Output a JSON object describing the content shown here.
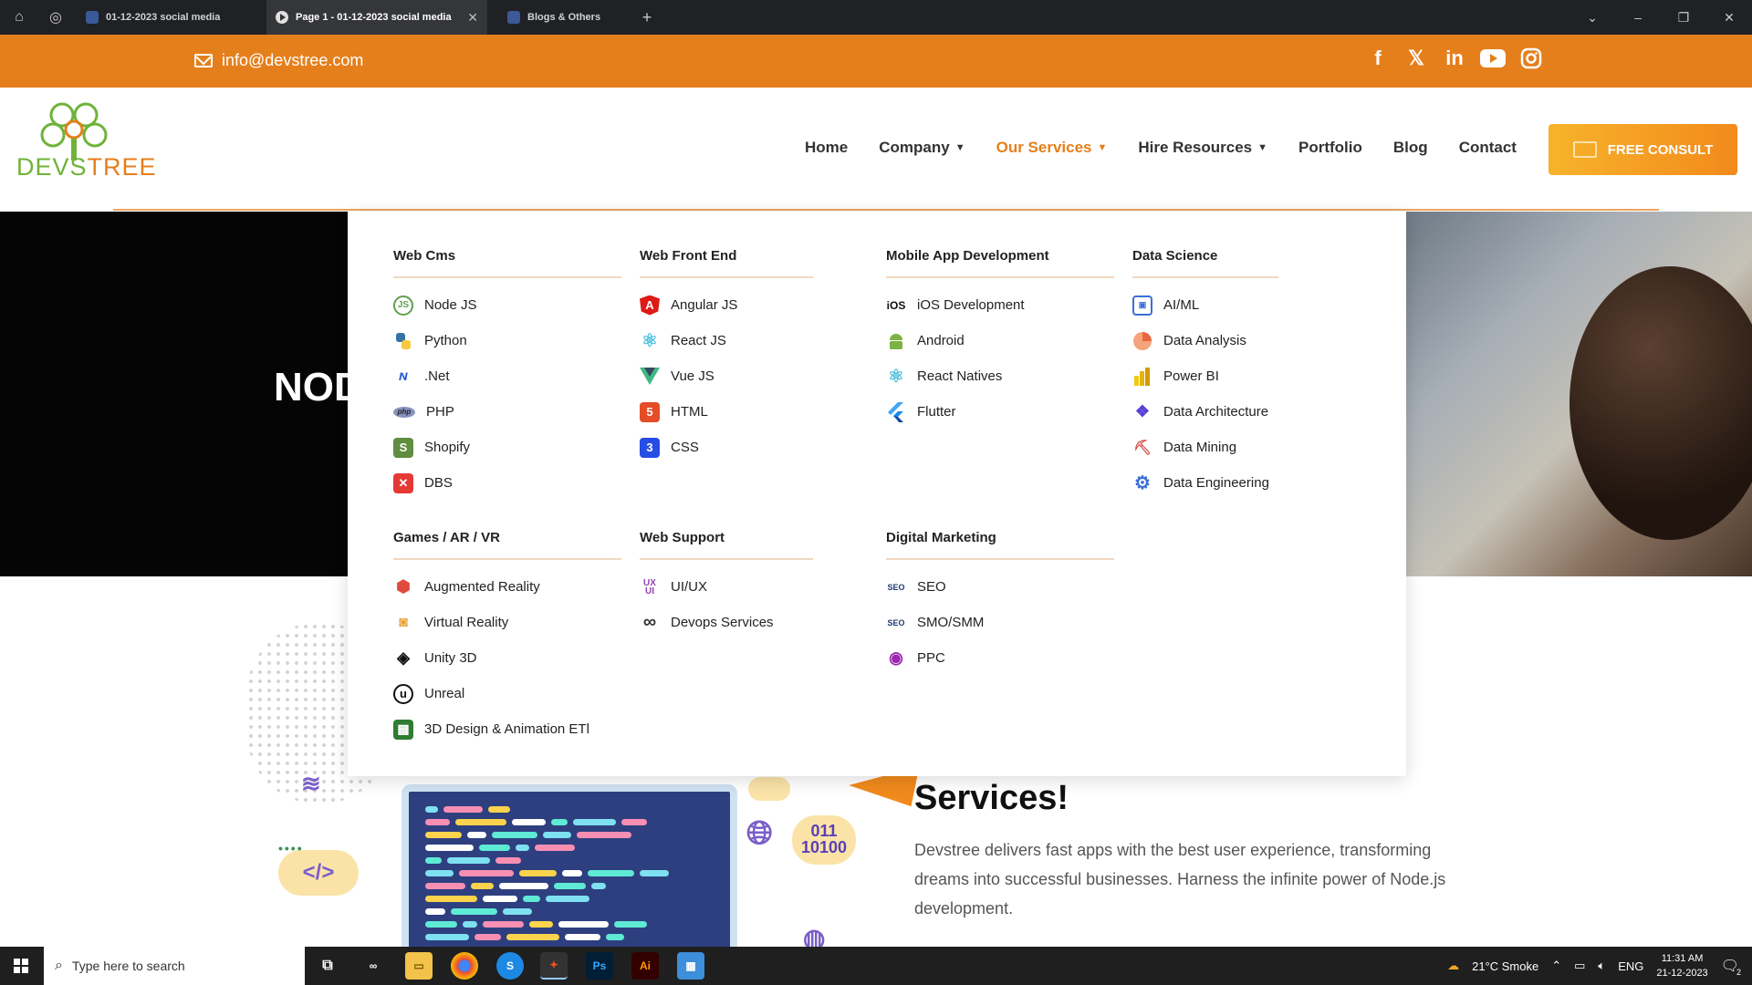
{
  "browser": {
    "tabs": [
      {
        "label": "01-12-2023 social media",
        "active": false
      },
      {
        "label": "Page 1 - 01-12-2023 social media",
        "active": true
      },
      {
        "label": "Blogs & Others",
        "active": false
      }
    ]
  },
  "topbar": {
    "email": "info@devstree.com",
    "social_icons": [
      "facebook-icon",
      "x-icon",
      "linkedin-icon",
      "youtube-icon",
      "instagram-icon"
    ]
  },
  "header": {
    "logo_text_a": "DEVS",
    "logo_text_b": "TREE",
    "nav": [
      {
        "label": "Home",
        "has_caret": false
      },
      {
        "label": "Company",
        "has_caret": true
      },
      {
        "label": "Our Services",
        "has_caret": true,
        "active": true
      },
      {
        "label": "Hire Resources",
        "has_caret": true
      },
      {
        "label": "Portfolio",
        "has_caret": false
      },
      {
        "label": "Blog",
        "has_caret": false
      },
      {
        "label": "Contact",
        "has_caret": false
      }
    ],
    "cta": "FREE CONSULT",
    "accent": "#e57f1c"
  },
  "hero": {
    "title": "NOD"
  },
  "mega_menu": {
    "columns": [
      {
        "title": "Web Cms",
        "items": [
          {
            "label": "Node JS",
            "icon": "nodejs-icon"
          },
          {
            "label": "Python",
            "icon": "python-icon"
          },
          {
            "label": ".Net",
            "icon": "dotnet-icon"
          },
          {
            "label": "PHP",
            "icon": "php-icon"
          },
          {
            "label": "Shopify",
            "icon": "shopify-icon"
          },
          {
            "label": "DBS",
            "icon": "dbs-icon"
          }
        ]
      },
      {
        "title": "Web Front End",
        "items": [
          {
            "label": "Angular JS",
            "icon": "angular-icon"
          },
          {
            "label": "React JS",
            "icon": "react-icon"
          },
          {
            "label": "Vue JS",
            "icon": "vue-icon"
          },
          {
            "label": "HTML",
            "icon": "html5-icon"
          },
          {
            "label": "CSS",
            "icon": "css3-icon"
          }
        ]
      },
      {
        "title": "Mobile App Development",
        "items": [
          {
            "label": "iOS Development",
            "icon": "ios-icon"
          },
          {
            "label": "Android",
            "icon": "android-icon"
          },
          {
            "label": "React Natives",
            "icon": "react-native-icon"
          },
          {
            "label": "Flutter",
            "icon": "flutter-icon"
          }
        ]
      },
      {
        "title": "Data Science",
        "items": [
          {
            "label": "AI/ML",
            "icon": "chip-icon"
          },
          {
            "label": "Data Analysis",
            "icon": "pie-chart-icon"
          },
          {
            "label": "Power BI",
            "icon": "powerbi-icon"
          },
          {
            "label": "Data Architecture",
            "icon": "cubes-icon"
          },
          {
            "label": "Data Mining",
            "icon": "mining-icon"
          },
          {
            "label": "Data Engineering",
            "icon": "gear-data-icon"
          }
        ]
      },
      {
        "title": "Games / AR / VR",
        "items": [
          {
            "label": "Augmented Reality",
            "icon": "ar-cube-icon"
          },
          {
            "label": "Virtual Reality",
            "icon": "vr-headset-icon"
          },
          {
            "label": "Unity  3D",
            "icon": "unity-icon"
          },
          {
            "label": "Unreal",
            "icon": "unreal-icon"
          },
          {
            "label": "3D Design & Animation ETl",
            "icon": "3d-box-icon"
          }
        ]
      },
      {
        "title": "Web Support",
        "items": [
          {
            "label": "UI/UX",
            "icon": "uiux-icon"
          },
          {
            "label": "Devops Services",
            "icon": "infinity-icon"
          }
        ]
      },
      {
        "title": "Digital Marketing",
        "items": [
          {
            "label": "SEO",
            "icon": "seo-icon"
          },
          {
            "label": "SMO/SMM",
            "icon": "smo-icon"
          },
          {
            "label": "PPC",
            "icon": "ppc-icon"
          }
        ]
      }
    ]
  },
  "section": {
    "heading": "Services!",
    "paragraph": "Devstree delivers fast apps with the best user experience, transforming dreams into successful businesses. Harness the infinite power of Node.js development.",
    "binary_text_1": "011",
    "binary_text_2": "10100",
    "code_tag": "</>"
  },
  "taskbar": {
    "search_placeholder": "Type here to search",
    "weather": "21°C  Smoke",
    "language": "ENG",
    "time": "11:31 AM",
    "date": "21-12-2023",
    "notification_count": "2"
  }
}
